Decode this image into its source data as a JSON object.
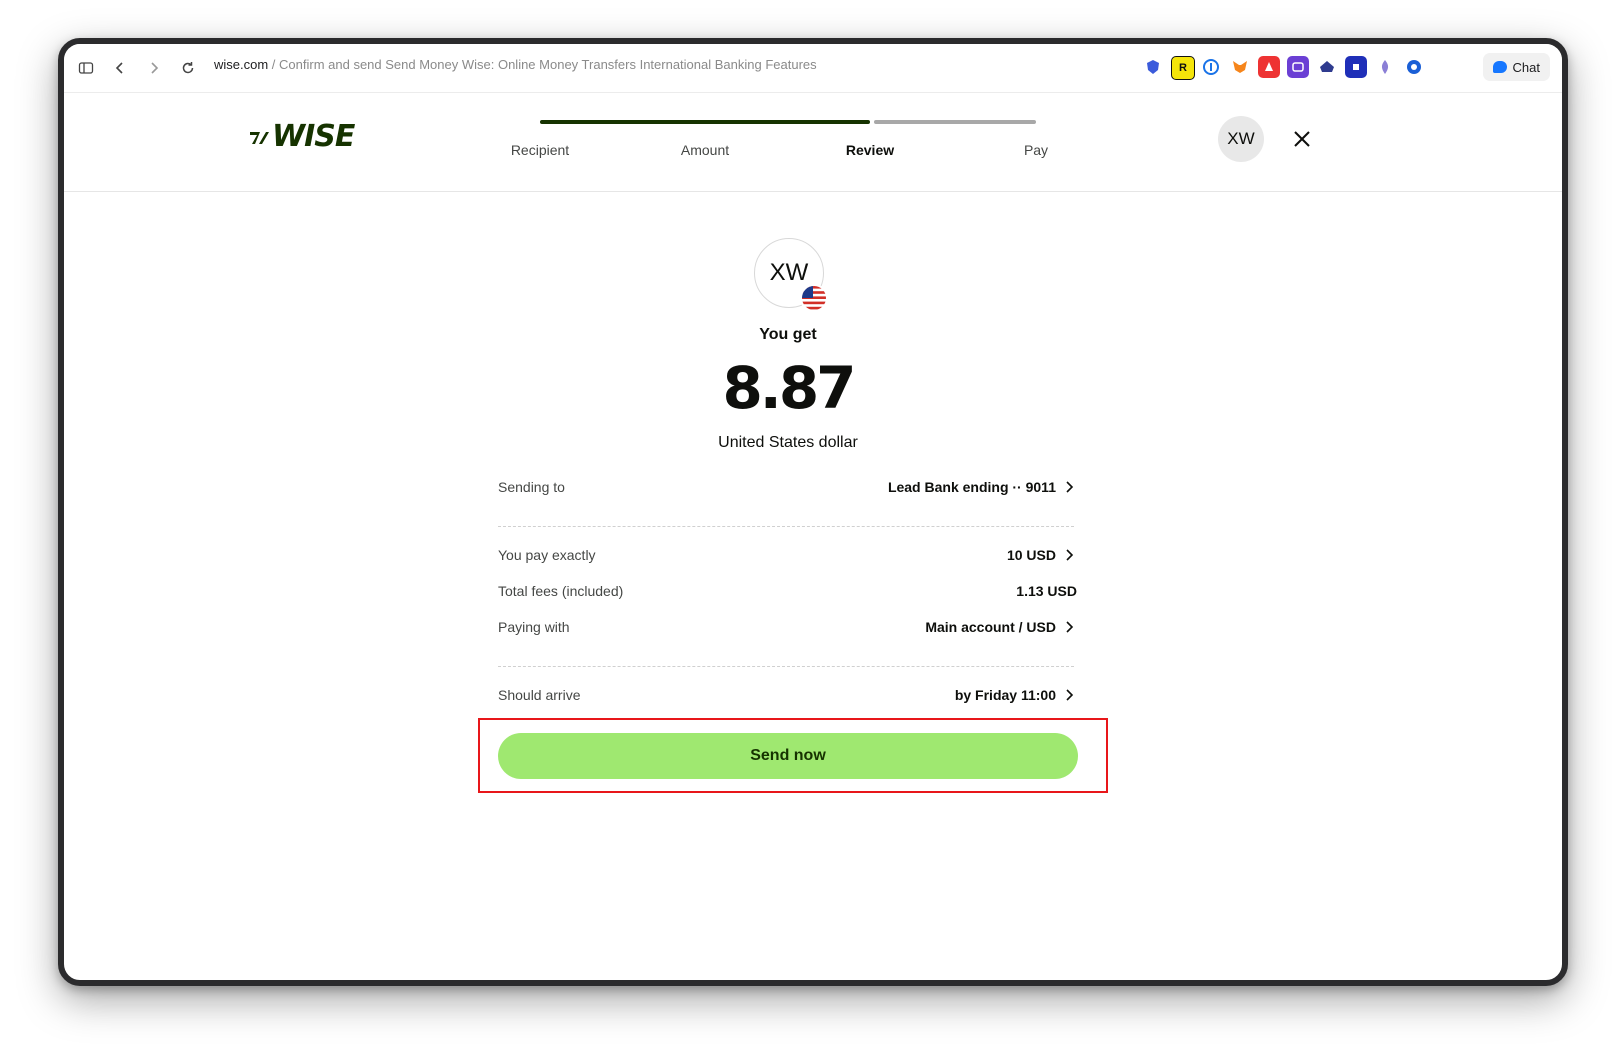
{
  "browser": {
    "url_host": "wise.com",
    "url_rest": " / Confirm and send Send Money Wise: Online Money Transfers International Banking Features",
    "chat_label": "Chat"
  },
  "header": {
    "logo_text": "WISE",
    "steps": [
      {
        "label": "Recipient",
        "state": "done"
      },
      {
        "label": "Amount",
        "state": "done"
      },
      {
        "label": "Review",
        "state": "active"
      },
      {
        "label": "Pay",
        "state": "pending"
      }
    ],
    "avatar_initials": "XW"
  },
  "summary": {
    "recipient_initials": "XW",
    "you_get_label": "You get",
    "amount": "8.87",
    "currency_name": "United States dollar"
  },
  "details": {
    "sending_to_label": "Sending to",
    "sending_to_value": "Lead Bank ending ·· 9011",
    "you_pay_label": "You pay exactly",
    "you_pay_value": "10 USD",
    "fees_label": "Total fees (included)",
    "fees_value": "1.13 USD",
    "paying_with_label": "Paying with",
    "paying_with_value": "Main account / USD",
    "arrive_label": "Should arrive",
    "arrive_value": "by Friday 11:00"
  },
  "actions": {
    "send_label": "Send now"
  },
  "colors": {
    "brand_green": "#9fe870",
    "brand_dark": "#163300",
    "highlight": "#e8171a"
  }
}
